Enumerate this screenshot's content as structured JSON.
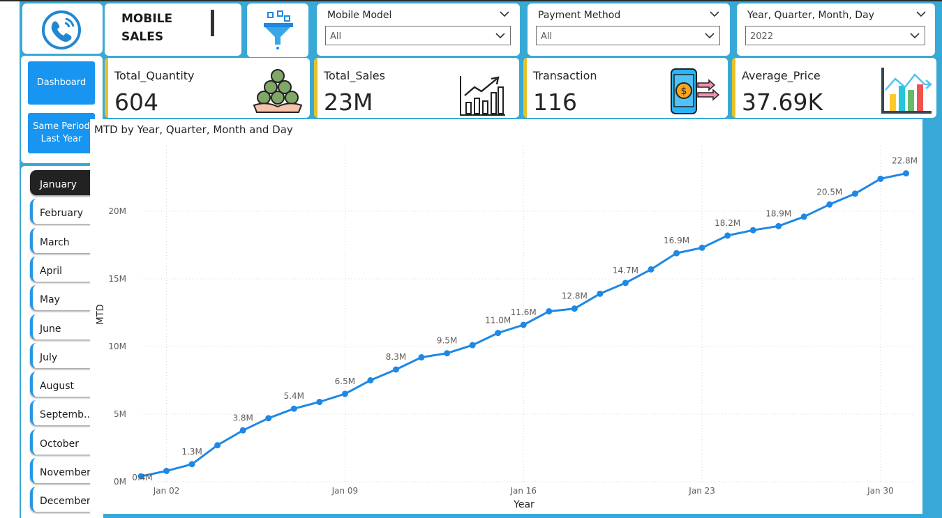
{
  "header": {
    "title_line1": "MOBILE",
    "title_line2": "SALES"
  },
  "icons": {
    "logo": "phone-call-icon",
    "filter": "funnel-filter-icon",
    "quantity": "money-hand-icon",
    "sales": "growth-bar-chart-icon",
    "transaction": "mobile-payment-icon",
    "price": "bar-chart-arrow-icon"
  },
  "slicers": [
    {
      "label": "Mobile Model",
      "value": "All"
    },
    {
      "label": "Payment Method",
      "value": "All"
    },
    {
      "label": "Year, Quarter, Month, Day",
      "value": "2022"
    }
  ],
  "kpis": [
    {
      "label": "Total_Quantity",
      "value": "604"
    },
    {
      "label": "Total_Sales",
      "value": "23M"
    },
    {
      "label": "Transaction",
      "value": "116"
    },
    {
      "label": "Average_Price",
      "value": "37.69K"
    }
  ],
  "nav": {
    "dashboard": "Dashboard",
    "spl_line1": "Same Period",
    "spl_line2": "Last Year"
  },
  "months": [
    "January",
    "February",
    "March",
    "April",
    "May",
    "June",
    "July",
    "August",
    "Septemb...",
    "October",
    "November",
    "December"
  ],
  "selected_month": "January",
  "colors": {
    "canvas": "#38a9d6",
    "accent_button": "#1895f0",
    "kpi_accent": "#e6c229",
    "series": "#1e88e5"
  },
  "chart_data": {
    "type": "line",
    "title": "MTD by Year, Quarter, Month and Day",
    "xlabel": "Year",
    "ylabel": "MTD",
    "ylim": [
      0,
      25000000
    ],
    "yticks": [
      "0M",
      "5M",
      "10M",
      "15M",
      "20M"
    ],
    "xticks": [
      "Jan 02",
      "Jan 09",
      "Jan 16",
      "Jan 23",
      "Jan 30"
    ],
    "x": [
      "2022-01-01",
      "2022-01-02",
      "2022-01-03",
      "2022-01-04",
      "2022-01-05",
      "2022-01-06",
      "2022-01-07",
      "2022-01-08",
      "2022-01-09",
      "2022-01-10",
      "2022-01-11",
      "2022-01-12",
      "2022-01-13",
      "2022-01-14",
      "2022-01-15",
      "2022-01-16",
      "2022-01-17",
      "2022-01-18",
      "2022-01-19",
      "2022-01-20",
      "2022-01-21",
      "2022-01-22",
      "2022-01-23",
      "2022-01-24",
      "2022-01-25",
      "2022-01-26",
      "2022-01-27",
      "2022-01-28",
      "2022-01-29",
      "2022-01-30",
      "2022-01-31"
    ],
    "values": [
      0.4,
      0.8,
      1.3,
      2.7,
      3.8,
      4.7,
      5.4,
      5.9,
      6.5,
      7.5,
      8.3,
      9.2,
      9.5,
      10.1,
      11.0,
      11.6,
      12.6,
      12.8,
      13.9,
      14.7,
      15.7,
      16.9,
      17.3,
      18.2,
      18.6,
      18.9,
      19.6,
      20.5,
      21.3,
      22.4,
      22.8
    ],
    "data_labels": [
      {
        "i": 0,
        "text": "0.4M"
      },
      {
        "i": 2,
        "text": "1.3M"
      },
      {
        "i": 4,
        "text": "3.8M"
      },
      {
        "i": 6,
        "text": "5.4M"
      },
      {
        "i": 8,
        "text": "6.5M"
      },
      {
        "i": 10,
        "text": "8.3M"
      },
      {
        "i": 12,
        "text": "9.5M"
      },
      {
        "i": 14,
        "text": "11.0M"
      },
      {
        "i": 15,
        "text": "11.6M"
      },
      {
        "i": 17,
        "text": "12.8M"
      },
      {
        "i": 19,
        "text": "14.7M"
      },
      {
        "i": 21,
        "text": "16.9M"
      },
      {
        "i": 23,
        "text": "18.2M"
      },
      {
        "i": 25,
        "text": "18.9M"
      },
      {
        "i": 27,
        "text": "20.5M"
      },
      {
        "i": 30,
        "text": "22.8M"
      }
    ],
    "grid": true
  }
}
